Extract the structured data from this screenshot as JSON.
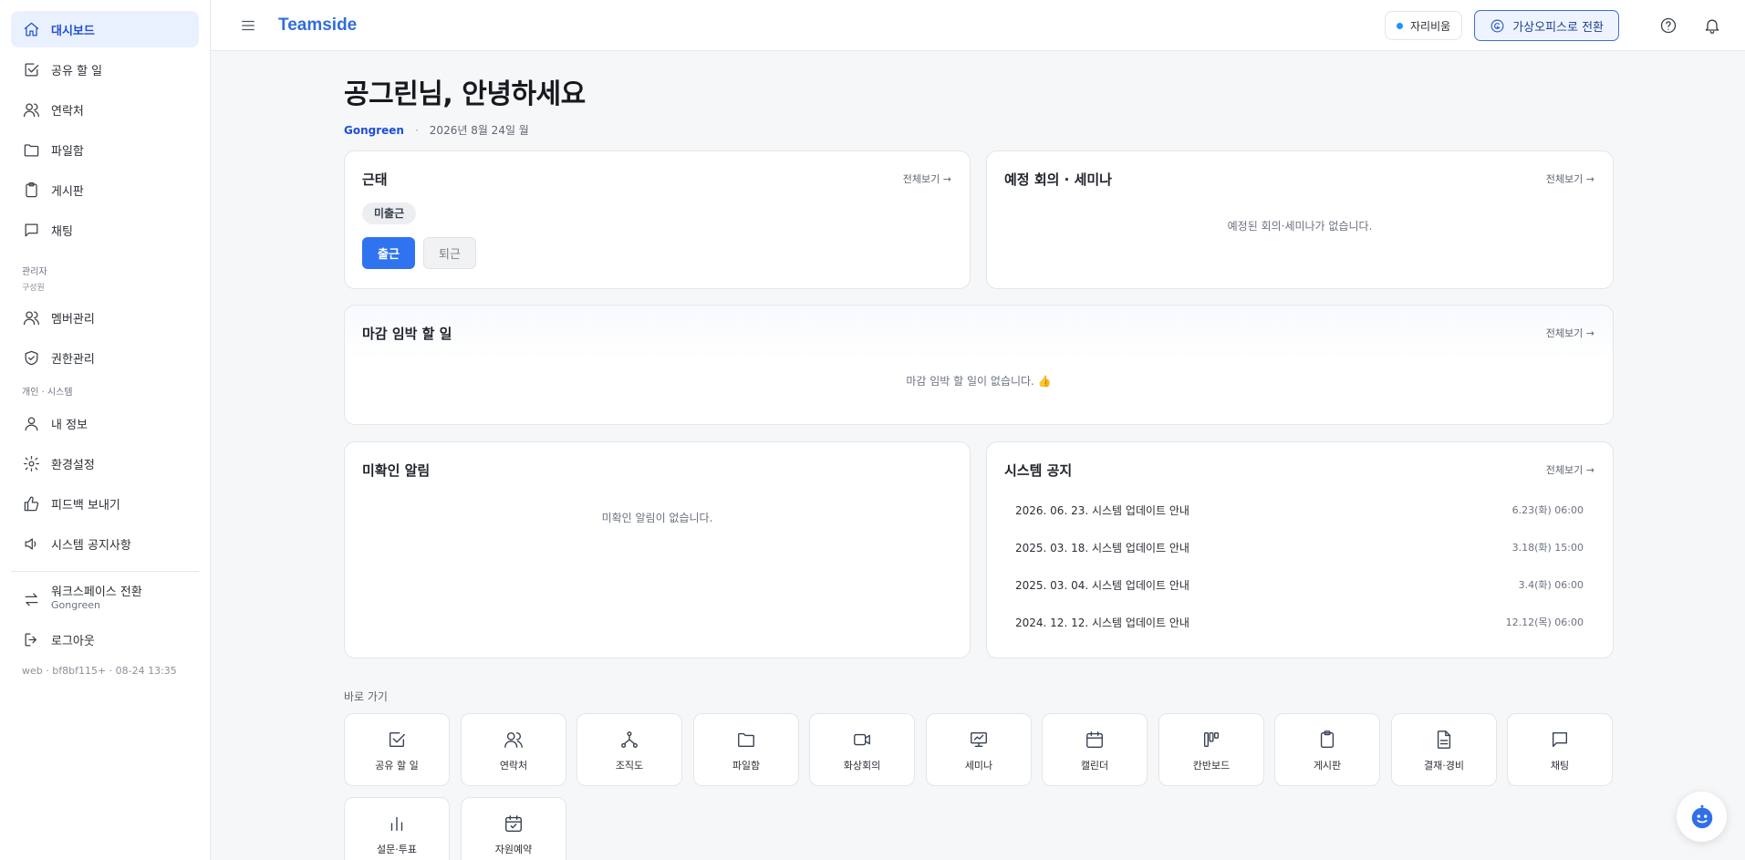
{
  "sidebar": {
    "items": [
      {
        "label": "대시보드",
        "icon": "home-icon"
      },
      {
        "label": "공유 할 일",
        "icon": "checkbox-icon"
      },
      {
        "label": "연락처",
        "icon": "users-icon"
      },
      {
        "label": "파일함",
        "icon": "folder-icon"
      },
      {
        "label": "게시판",
        "icon": "clipboard-icon"
      },
      {
        "label": "채팅",
        "icon": "chat-icon"
      }
    ],
    "admin_label": "관리자",
    "admin_sub": "구성원",
    "admin_items": [
      {
        "label": "멤버관리",
        "icon": "users-icon"
      },
      {
        "label": "권한관리",
        "icon": "shield-check-icon"
      }
    ],
    "personal_label": "개인 · 시스템",
    "personal_items": [
      {
        "label": "내 정보",
        "icon": "user-icon"
      },
      {
        "label": "환경설정",
        "icon": "gear-icon"
      },
      {
        "label": "피드백 보내기",
        "icon": "thumbs-up-icon"
      },
      {
        "label": "시스템 공지사항",
        "icon": "speaker-icon"
      }
    ],
    "workspace_switch": {
      "label": "워크스페이스 전환",
      "sub": "Gongreen"
    },
    "logout_label": "로그아웃",
    "build_info": "web · bf8bf115+ · 08-24 13:35"
  },
  "topbar": {
    "brand": "Teamside",
    "status_chip": "자리비움",
    "office_button": "가상오피스로 전환"
  },
  "header": {
    "greeting": "공그린님, 안녕하세요",
    "workspace": "Gongreen",
    "separator": "·",
    "date": "2026년 8월 24일 월"
  },
  "cards": {
    "attendance": {
      "title": "근태",
      "view_all": "전체보기 →",
      "status_badge": "미출근",
      "check_in": "출근",
      "check_out": "퇴근"
    },
    "meetings": {
      "title": "예정 회의 · 세미나",
      "view_all": "전체보기 →",
      "empty": "예정된 회의·세미나가 없습니다."
    },
    "deadline": {
      "title": "마감 임박 할 일",
      "view_all": "전체보기 →",
      "empty": "마감 임박 할 일이 없습니다. 👍"
    },
    "unread": {
      "title": "미확인 알림",
      "empty": "미확인 알림이 없습니다."
    },
    "system_notice": {
      "title": "시스템 공지",
      "view_all": "전체보기 →",
      "items": [
        {
          "title": "2026. 06. 23. 시스템 업데이트 안내",
          "time": "6.23(화) 06:00"
        },
        {
          "title": "2025. 03. 18. 시스템 업데이트 안내",
          "time": "3.18(화) 15:00"
        },
        {
          "title": "2025. 03. 04. 시스템 업데이트 안내",
          "time": "3.4(화) 06:00"
        },
        {
          "title": "2024. 12. 12. 시스템 업데이트 안내",
          "time": "12.12(목) 06:00"
        }
      ]
    }
  },
  "quick_links": {
    "label": "바로 가기",
    "items": [
      {
        "label": "공유 할 일",
        "icon": "checkbox-icon"
      },
      {
        "label": "연락처",
        "icon": "users-icon"
      },
      {
        "label": "조직도",
        "icon": "org-chart-icon"
      },
      {
        "label": "파일함",
        "icon": "folder-icon"
      },
      {
        "label": "화상회의",
        "icon": "video-icon"
      },
      {
        "label": "세미나",
        "icon": "presentation-icon"
      },
      {
        "label": "캘린더",
        "icon": "calendar-icon"
      },
      {
        "label": "칸반보드",
        "icon": "kanban-icon"
      },
      {
        "label": "게시판",
        "icon": "clipboard-icon"
      },
      {
        "label": "결재·경비",
        "icon": "document-icon"
      },
      {
        "label": "채팅",
        "icon": "chat-icon"
      },
      {
        "label": "설문·투표",
        "icon": "bar-chart-icon"
      },
      {
        "label": "자원예약",
        "icon": "calendar-check-icon"
      }
    ]
  },
  "colors": {
    "accent": "#2f73f0",
    "brand": "#2f6fd8",
    "active_bg": "#eaf1fe",
    "status_dot": "#1e90ff"
  }
}
